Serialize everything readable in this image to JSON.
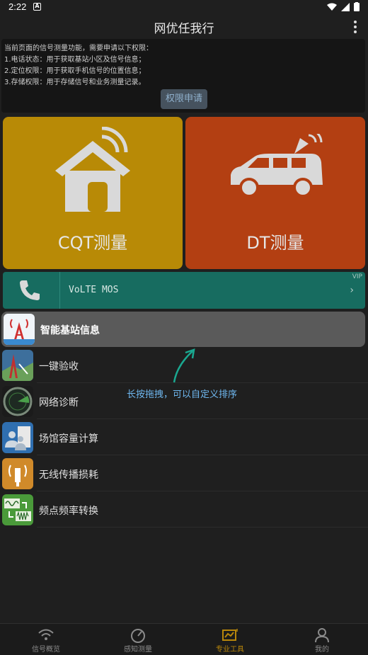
{
  "status": {
    "time": "2:22",
    "notif": "A"
  },
  "app": {
    "title": "网优任我行"
  },
  "permission": {
    "lines": [
      "当前页面的信号测量功能，需要申请以下权限：",
      "1.电话状态：用于获取基站小区及信号信息；",
      "2.定位权限：用于获取手机信号的位置信息；",
      "3.存储权限：用于存储信号和业务测量记录。"
    ],
    "button": "权限申请"
  },
  "tiles": {
    "cqt": "CQT测量",
    "dt": "DT测量"
  },
  "volte": {
    "label": "VoLTE MOS",
    "badge": "VIP",
    "chevron": "›"
  },
  "tools": [
    {
      "label": "智能基站信息",
      "icon": "tower-icon"
    },
    {
      "label": "一键验收",
      "icon": "tower-map-icon"
    },
    {
      "label": "网络诊断",
      "icon": "radar-icon"
    },
    {
      "label": "场馆容量计算",
      "icon": "venue-icon"
    },
    {
      "label": "无线传播损耗",
      "icon": "antenna-icon"
    },
    {
      "label": "频点频率转换",
      "icon": "wave-icon"
    }
  ],
  "hint": "长按拖拽，可以自定义排序",
  "tabs": [
    {
      "label": "信号概览",
      "icon": "wifi-icon"
    },
    {
      "label": "感知测量",
      "icon": "gauge-icon"
    },
    {
      "label": "专业工具",
      "icon": "chart-icon"
    },
    {
      "label": "我的",
      "icon": "person-icon"
    }
  ],
  "colors": {
    "cqt": "#b88a06",
    "dt": "#b33f12",
    "volte": "#176c60",
    "activeTab": "#b8860b",
    "hint": "#6fb8f0"
  }
}
